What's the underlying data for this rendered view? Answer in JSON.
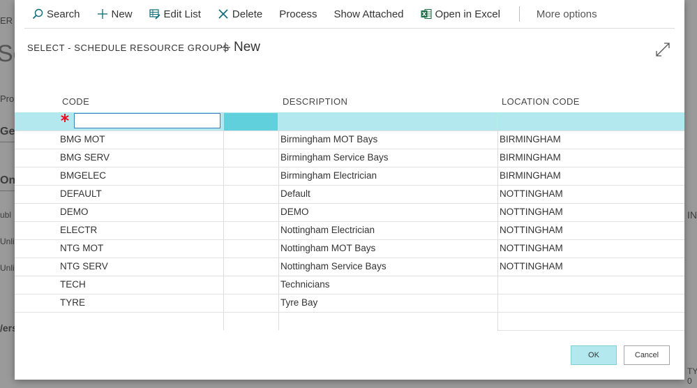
{
  "background_page": {
    "fragments": [
      "ER",
      "Se",
      "Pro",
      "Gen",
      "Onl",
      "ubl",
      "Unli",
      "Unli",
      "/ers",
      "INI",
      "TY",
      "0"
    ]
  },
  "action_bar": {
    "search": "Search",
    "new": "New",
    "edit_list": "Edit List",
    "delete": "Delete",
    "process": "Process",
    "show_attached": "Show Attached",
    "open_in_excel": "Open in Excel",
    "more_options": "More options"
  },
  "page": {
    "caption": "SELECT - SCHEDULE RESOURCE GROUPS",
    "new_label": "New"
  },
  "table": {
    "headers": {
      "code": "CODE",
      "description": "DESCRIPTION",
      "location_code": "LOCATION CODE"
    },
    "new_row": {
      "code_value": ""
    },
    "rows": [
      {
        "code": "BMG MOT",
        "description": "Birmingham MOT Bays",
        "location_code": "BIRMINGHAM"
      },
      {
        "code": "BMG SERV",
        "description": "Birmingham Service Bays",
        "location_code": "BIRMINGHAM"
      },
      {
        "code": "BMGELEC",
        "description": "Birmingham Electrician",
        "location_code": "BIRMINGHAM"
      },
      {
        "code": "DEFAULT",
        "description": "Default",
        "location_code": "NOTTINGHAM"
      },
      {
        "code": "DEMO",
        "description": "DEMO",
        "location_code": "NOTTINGHAM"
      },
      {
        "code": "ELECTR",
        "description": "Nottingham Electrician",
        "location_code": "NOTTINGHAM"
      },
      {
        "code": "NTG MOT",
        "description": "Nottingham MOT Bays",
        "location_code": "NOTTINGHAM"
      },
      {
        "code": "NTG SERV",
        "description": "Nottingham Service Bays",
        "location_code": "NOTTINGHAM"
      },
      {
        "code": "TECH",
        "description": "Technicians",
        "location_code": ""
      },
      {
        "code": "TYRE",
        "description": "Tyre Bay",
        "location_code": ""
      }
    ]
  },
  "footer": {
    "ok": "OK",
    "cancel": "Cancel"
  },
  "colors": {
    "selected_row": "#b3e9ee",
    "selected_cell": "#5fd0dc",
    "excel_green": "#1e7145",
    "accent_teal": "#0b6a77",
    "required_star": "#e81123"
  },
  "icons": {
    "search": "search-icon",
    "new": "plus-icon",
    "edit_list": "edit-list-icon",
    "delete": "close-x-icon",
    "excel": "excel-icon",
    "expand": "expand-icon",
    "required": "required-asterisk-icon"
  }
}
